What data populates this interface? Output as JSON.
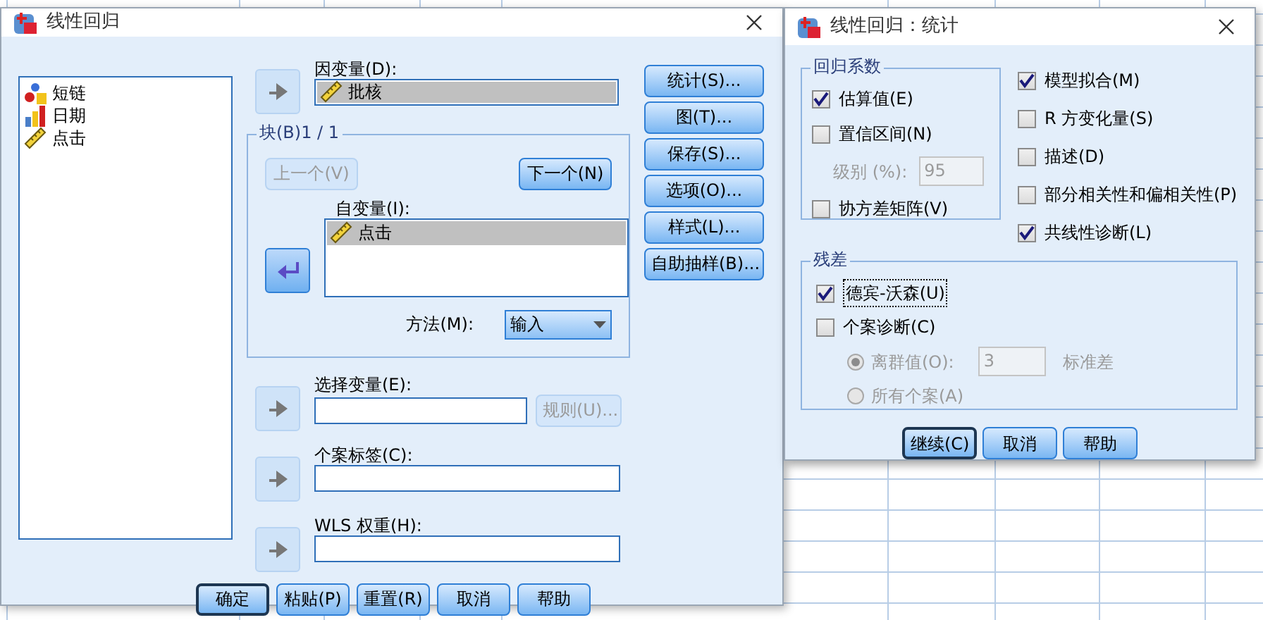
{
  "main_dialog": {
    "title": "线性回归",
    "variables": [
      {
        "name": "短链",
        "kind": "nominal"
      },
      {
        "name": "日期",
        "kind": "ordinal"
      },
      {
        "name": "点击",
        "kind": "scale"
      }
    ],
    "dependent": {
      "label": "因变量(D):",
      "value": "批核",
      "kind": "scale"
    },
    "block": {
      "legend": "块(B)1 / 1",
      "prev_button": {
        "label": "上一个(V)",
        "disabled": true
      },
      "next_button": {
        "label": "下一个(N)",
        "disabled": false
      },
      "independents_label": "自变量(I):",
      "independents": [
        {
          "name": "点击",
          "kind": "scale"
        }
      ],
      "method_label": "方法(M):",
      "method_value": "输入"
    },
    "selection": {
      "label": "选择变量(E):",
      "rule_button": {
        "label": "规则(U)...",
        "disabled": true
      }
    },
    "case_labels": {
      "label": "个案标签(C):"
    },
    "wls": {
      "label": "WLS 权重(H):"
    },
    "side_buttons": [
      "统计(S)...",
      "图(T)...",
      "保存(S)...",
      "选项(O)...",
      "样式(L)...",
      "自助抽样(B)..."
    ],
    "bottom_buttons": [
      {
        "label": "确定",
        "default": true
      },
      {
        "label": "粘贴(P)",
        "default": false
      },
      {
        "label": "重置(R)",
        "default": false
      },
      {
        "label": "取消",
        "default": false
      },
      {
        "label": "帮助",
        "default": false
      }
    ]
  },
  "stats_dialog": {
    "title": "线性回归：统计",
    "coefficients": {
      "legend": "回归系数",
      "estimates": {
        "label": "估算值(E)",
        "checked": true
      },
      "confidence": {
        "label": "置信区间(N)",
        "checked": false
      },
      "level_label": "级别 (%):",
      "level_value": "95",
      "covariance": {
        "label": "协方差矩阵(V)",
        "checked": false
      }
    },
    "right_checks": [
      {
        "label": "模型拟合(M)",
        "checked": true
      },
      {
        "label": "R 方变化量(S)",
        "checked": false
      },
      {
        "label": "描述(D)",
        "checked": false
      },
      {
        "label": "部分相关性和偏相关性(P)",
        "checked": false
      },
      {
        "label": "共线性诊断(L)",
        "checked": true
      }
    ],
    "residuals": {
      "legend": "残差",
      "durbin": {
        "label": "德宾-沃森(U)",
        "checked": true
      },
      "casewise": {
        "label": "个案诊断(C)",
        "checked": false
      },
      "outliers": {
        "label": "离群值(O):",
        "selected": true,
        "value": "3",
        "unit": "标准差"
      },
      "all_cases": {
        "label": "所有个案(A)",
        "selected": false
      }
    },
    "buttons": [
      {
        "label": "继续(C)",
        "default": true
      },
      {
        "label": "取消",
        "default": false
      },
      {
        "label": "帮助",
        "default": false
      }
    ]
  }
}
